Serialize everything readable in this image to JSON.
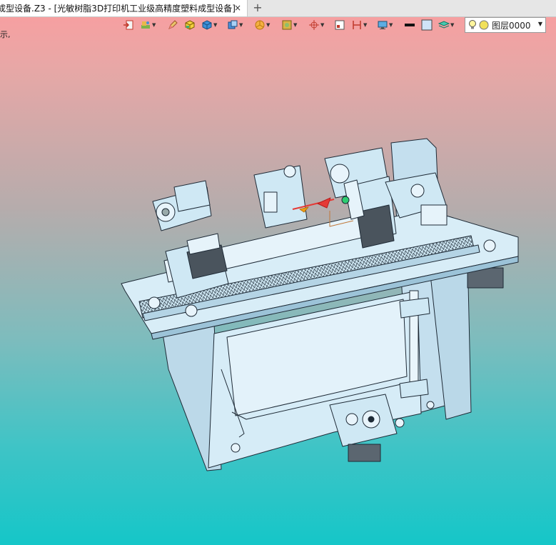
{
  "window": {
    "tab_title": "成型设备.Z3 - [光敏树脂3D打印机工业级高精度塑料成型设备]",
    "tab_close": "×",
    "tab_add": "+"
  },
  "side_text": "示,",
  "toolbar": {
    "icons": [
      "exit-icon",
      "layers-icon",
      "pencil-icon",
      "solid-cube-icon",
      "blue-cube-icon",
      "view-cube-icon",
      "pie-render-icon",
      "image-icon",
      "axis-icon",
      "frame-icon",
      "dimension-icon",
      "monitor-icon",
      "line-color-icon",
      "fill-swatch-icon",
      "stack-icon"
    ],
    "layer_label": "图层0000",
    "layer_arrow": "▼"
  },
  "colors": {
    "tab_active": "#ffffff",
    "tabbar": "#e6e6e6",
    "bg_top": "#fb9d9f",
    "bg_bottom": "#15c6c8",
    "model_fill": "#cfe8f4",
    "model_stroke": "#1e2a36"
  }
}
